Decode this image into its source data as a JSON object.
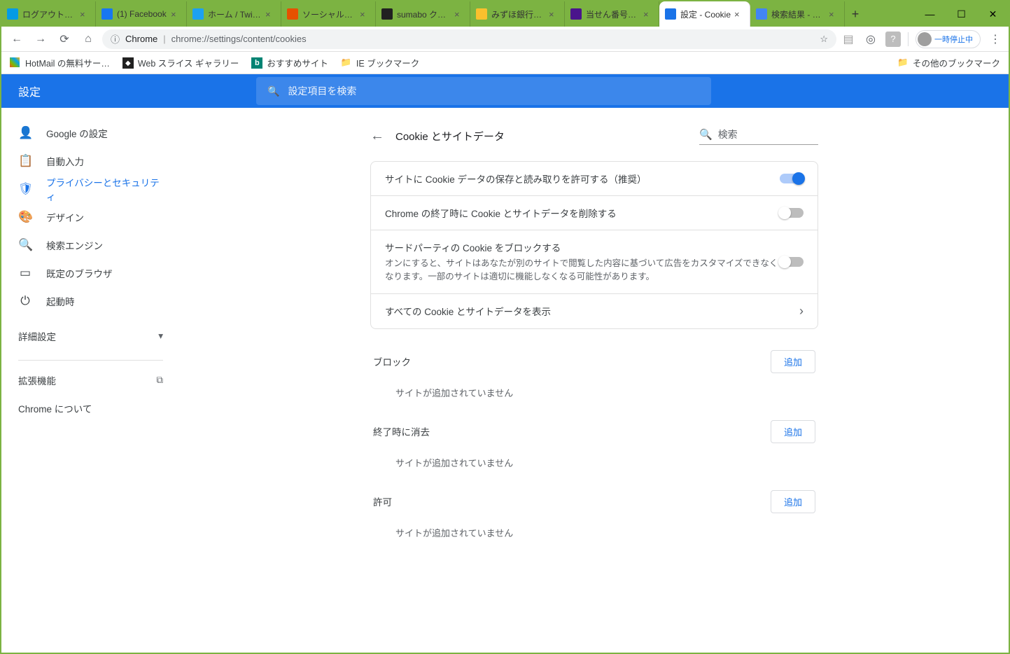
{
  "window": {
    "minimize": "—",
    "maximize": "☐",
    "close": "✕"
  },
  "tabs": [
    {
      "title": "ログアウト：W…",
      "favcolor": "#039be5"
    },
    {
      "title": "(1) Facebook",
      "favcolor": "#1877f2"
    },
    {
      "title": "ホーム / Twitt…",
      "favcolor": "#1da1f2"
    },
    {
      "title": "ソーシャル・ネッ…",
      "favcolor": "#e65100"
    },
    {
      "title": "sumabo クリ…",
      "favcolor": "#212121"
    },
    {
      "title": "みずほ銀行：…",
      "favcolor": "#fbc02d"
    },
    {
      "title": "当せん番号案…",
      "favcolor": "#4a148c"
    },
    {
      "title": "設定 - Cookie",
      "favcolor": "#1a73e8",
      "active": true
    },
    {
      "title": "検索結果 - G…",
      "favcolor": "#4285f4"
    }
  ],
  "newtab": "+",
  "toolbar": {
    "chrome_label": "Chrome",
    "url": "chrome://settings/content/cookies",
    "paused": "一時停止中",
    "menu": "⋮"
  },
  "bookmarks": {
    "items": [
      {
        "label": "HotMail の無料サー…",
        "icon": "ms"
      },
      {
        "label": "Web スライス ギャラリー",
        "icon": "cube"
      },
      {
        "label": "おすすめサイト",
        "icon": "bing"
      },
      {
        "label": "IE ブックマーク",
        "icon": "folder"
      }
    ],
    "other": "その他のブックマーク"
  },
  "settings": {
    "title": "設定",
    "search_placeholder": "設定項目を検索",
    "nav": [
      {
        "icon": "👤",
        "label": "Google の設定"
      },
      {
        "icon": "📋",
        "label": "自動入力"
      },
      {
        "icon": "🛡",
        "label": "プライバシーとセキュリティ",
        "active": true
      },
      {
        "icon": "🎨",
        "label": "デザイン"
      },
      {
        "icon": "🔍",
        "label": "検索エンジン"
      },
      {
        "icon": "▭",
        "label": "既定のブラウザ"
      },
      {
        "icon": "⏻",
        "label": "起動時"
      }
    ],
    "advanced": "詳細設定",
    "extensions": "拡張機能",
    "about": "Chrome について"
  },
  "panel": {
    "title": "Cookie とサイトデータ",
    "search": "検索",
    "rows": [
      {
        "label": "サイトに Cookie データの保存と読み取りを許可する（推奨）",
        "toggle": "on"
      },
      {
        "label": "Chrome の終了時に Cookie とサイトデータを削除する",
        "toggle": "off"
      },
      {
        "label": "サードパーティの Cookie をブロックする",
        "sub": "オンにすると、サイトはあなたが別のサイトで閲覧した内容に基づいて広告をカスタマイズできなくなります。一部のサイトは適切に機能しなくなる可能性があります。",
        "toggle": "off"
      },
      {
        "label": "すべての Cookie とサイトデータを表示",
        "chevron": true
      }
    ],
    "sections": [
      {
        "title": "ブロック",
        "add": "追加",
        "empty": "サイトが追加されていません"
      },
      {
        "title": "終了時に消去",
        "add": "追加",
        "empty": "サイトが追加されていません"
      },
      {
        "title": "許可",
        "add": "追加",
        "empty": "サイトが追加されていません"
      }
    ]
  }
}
